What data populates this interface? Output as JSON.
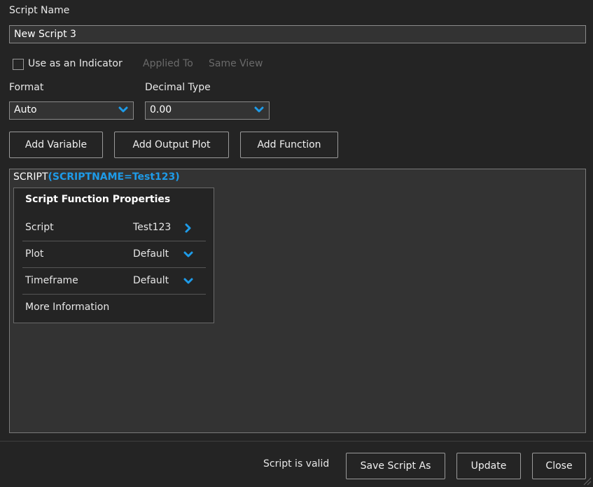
{
  "colors": {
    "background": "#242424",
    "field": "#333333",
    "accent": "#1e9be8",
    "border": "#8a8a8a"
  },
  "script_name": {
    "label": "Script Name",
    "value": "New Script 3"
  },
  "indicator": {
    "label": "Use as an Indicator",
    "checked": false,
    "applied_to_label": "Applied To",
    "applied_to_value": "Same View"
  },
  "format": {
    "label": "Format",
    "selected": "Auto"
  },
  "decimal_type": {
    "label": "Decimal Type",
    "selected": "0.00"
  },
  "toolbar": {
    "add_variable": "Add Variable",
    "add_output_plot": "Add Output Plot",
    "add_function": "Add Function"
  },
  "editor": {
    "keyword": "SCRIPT",
    "argument": "(SCRIPTNAME=Test123)",
    "popup": {
      "title": "Script Function Properties",
      "rows": [
        {
          "key": "Script",
          "value": "Test123",
          "icon": "chevron-right-icon"
        },
        {
          "key": "Plot",
          "value": "Default",
          "icon": "chevron-down-icon"
        },
        {
          "key": "Timeframe",
          "value": "Default",
          "icon": "chevron-down-icon"
        }
      ],
      "more_info": "More Information"
    }
  },
  "footer": {
    "status": "Script is valid",
    "save_as": "Save Script As",
    "update": "Update",
    "close": "Close"
  }
}
